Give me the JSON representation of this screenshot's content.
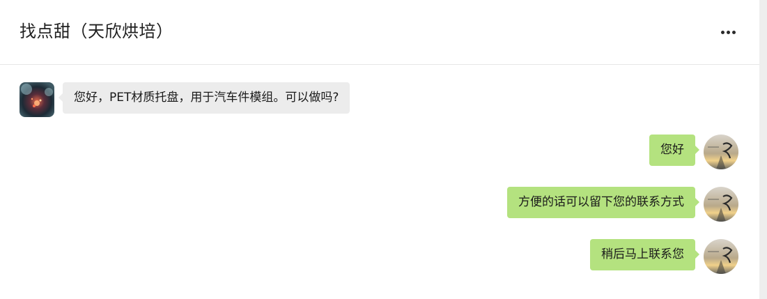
{
  "chat": {
    "title": "找点甜（天欣烘培）",
    "menu_icon": "more-horizontal-icon"
  },
  "messages": [
    {
      "direction": "in",
      "text": "您好，PET材质托盘，用于汽车件模组。可以做吗?",
      "avatar": "contact-avatar"
    },
    {
      "direction": "out",
      "text": "您好",
      "avatar": "self-avatar"
    },
    {
      "direction": "out",
      "text": "方便的话可以留下您的联系方式",
      "avatar": "self-avatar"
    },
    {
      "direction": "out",
      "text": "稍后马上联系您",
      "avatar": "self-avatar"
    }
  ],
  "colors": {
    "incoming_bubble": "#ececec",
    "outgoing_bubble": "#b4e27f",
    "header_divider": "#e7e7e7"
  }
}
